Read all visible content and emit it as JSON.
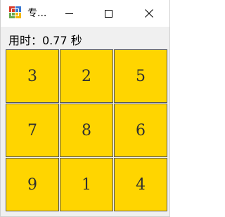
{
  "window": {
    "title": "专...",
    "controls": {
      "minimize_icon": "minimize-icon",
      "maximize_icon": "maximize-icon",
      "close_icon": "close-icon"
    }
  },
  "timer": {
    "text": "用时：0.77 秒"
  },
  "puzzle": {
    "tiles": [
      "3",
      "2",
      "5",
      "7",
      "8",
      "6",
      "9",
      "1",
      "4"
    ],
    "colors": {
      "tile_fill": "#ffd500",
      "tile_border": "#585858",
      "tile_text": "#303030"
    }
  }
}
